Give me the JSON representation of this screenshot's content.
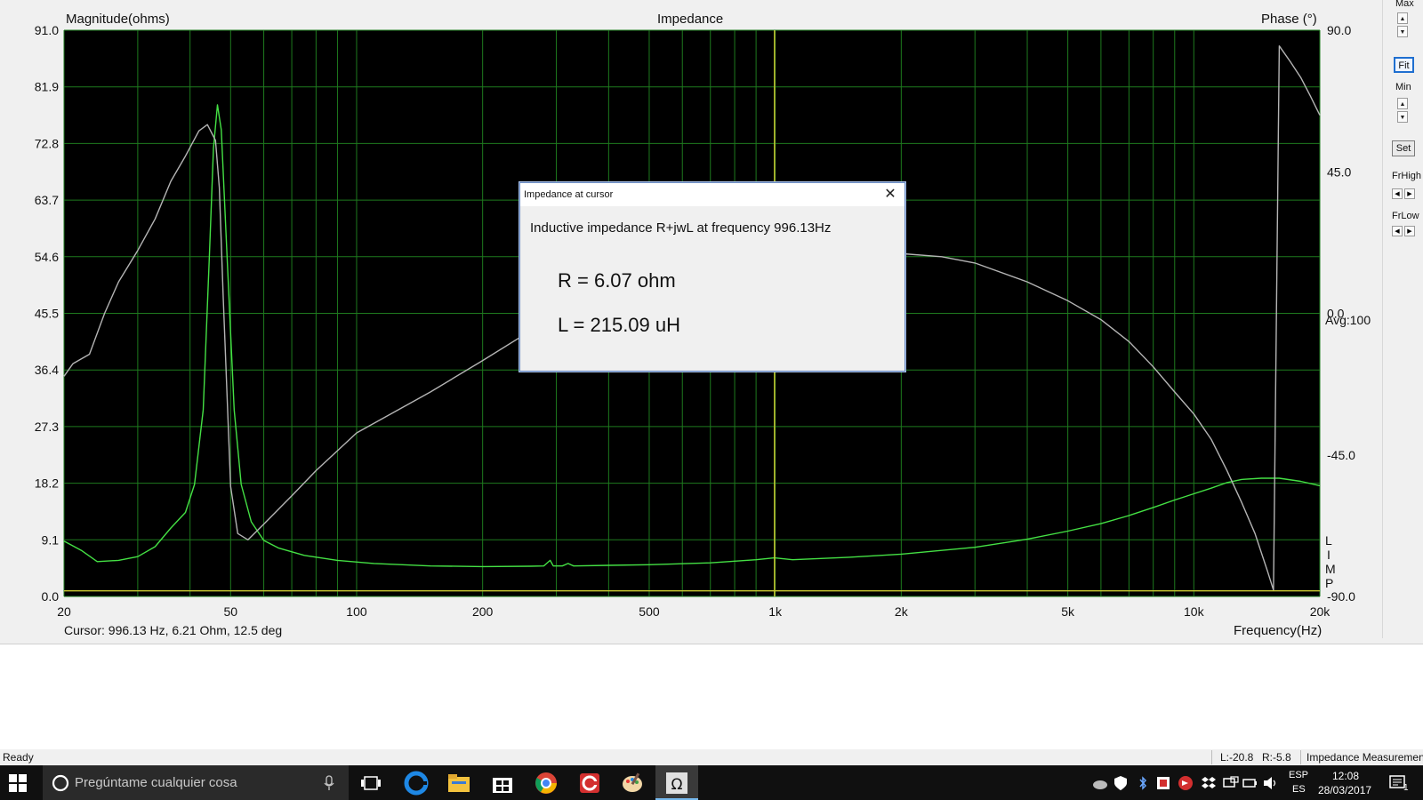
{
  "chart_data": {
    "type": "line",
    "title": "Impedance",
    "ylabel_left": "Magnitude(ohms)",
    "ylabel_right": "Phase (°)",
    "xlabel": "Frequency(Hz)",
    "x_scale": "log",
    "xlim": [
      20,
      20000
    ],
    "ylim_left": [
      0,
      91
    ],
    "ylim_right": [
      -90,
      90
    ],
    "grid": true,
    "background": "#000000",
    "grid_color": "#1e7a1e",
    "x_ticks": [
      {
        "value": 20,
        "label": "20"
      },
      {
        "value": 50,
        "label": "50"
      },
      {
        "value": 100,
        "label": "100"
      },
      {
        "value": 200,
        "label": "200"
      },
      {
        "value": 500,
        "label": "500"
      },
      {
        "value": 1000,
        "label": "1k"
      },
      {
        "value": 2000,
        "label": "2k"
      },
      {
        "value": 5000,
        "label": "5k"
      },
      {
        "value": 10000,
        "label": "10k"
      },
      {
        "value": 20000,
        "label": "20k"
      }
    ],
    "y_ticks_left": [
      "0.0",
      "9.1",
      "18.2",
      "27.3",
      "36.4",
      "45.5",
      "54.6",
      "63.7",
      "72.8",
      "81.9",
      "91.0"
    ],
    "y_ticks_right": [
      {
        "value": 90,
        "label": "90.0"
      },
      {
        "value": 45,
        "label": "45.0"
      },
      {
        "value": 0,
        "label": "0.0"
      },
      {
        "value": -45,
        "label": "-45.0"
      },
      {
        "value": -90,
        "label": "-90.0"
      }
    ],
    "cursor_x": 996.13,
    "series": [
      {
        "color": "#44e044",
        "axis": "left",
        "points": [
          [
            20,
            8.9
          ],
          [
            22,
            7.4
          ],
          [
            24,
            5.6
          ],
          [
            27,
            5.8
          ],
          [
            30,
            6.4
          ],
          [
            33,
            8.0
          ],
          [
            36,
            11.0
          ],
          [
            39,
            13.5
          ],
          [
            41,
            18.0
          ],
          [
            43,
            30.0
          ],
          [
            44.5,
            55.0
          ],
          [
            45.5,
            72.0
          ],
          [
            46.5,
            79.0
          ],
          [
            47.5,
            75.0
          ],
          [
            49,
            55.0
          ],
          [
            51,
            30.0
          ],
          [
            53,
            18.0
          ],
          [
            56,
            12.0
          ],
          [
            60,
            9.0
          ],
          [
            65,
            7.8
          ],
          [
            75,
            6.6
          ],
          [
            90,
            5.8
          ],
          [
            110,
            5.3
          ],
          [
            150,
            4.9
          ],
          [
            200,
            4.8
          ],
          [
            260,
            4.85
          ],
          [
            280,
            4.9
          ],
          [
            290,
            5.8
          ],
          [
            295,
            4.9
          ],
          [
            310,
            4.9
          ],
          [
            320,
            5.3
          ],
          [
            330,
            4.9
          ],
          [
            400,
            5.0
          ],
          [
            500,
            5.1
          ],
          [
            700,
            5.4
          ],
          [
            900,
            5.9
          ],
          [
            996,
            6.2
          ],
          [
            1100,
            5.9
          ],
          [
            1500,
            6.3
          ],
          [
            2000,
            6.8
          ],
          [
            3000,
            7.9
          ],
          [
            4000,
            9.2
          ],
          [
            5000,
            10.5
          ],
          [
            6000,
            11.7
          ],
          [
            7000,
            13.0
          ],
          [
            8000,
            14.3
          ],
          [
            9000,
            15.5
          ],
          [
            10000,
            16.5
          ],
          [
            11000,
            17.4
          ],
          [
            12000,
            18.3
          ],
          [
            13000,
            18.8
          ],
          [
            14500,
            19.0
          ],
          [
            16000,
            19.0
          ],
          [
            18000,
            18.5
          ],
          [
            20000,
            17.8
          ]
        ]
      },
      {
        "color": "#b4b4b4",
        "axis": "right",
        "points": [
          [
            20,
            -20.0
          ],
          [
            21,
            -16.0
          ],
          [
            23,
            -13.0
          ],
          [
            25,
            0.0
          ],
          [
            27,
            10.0
          ],
          [
            30,
            20.0
          ],
          [
            33,
            30.0
          ],
          [
            36,
            42.0
          ],
          [
            39,
            50.0
          ],
          [
            42,
            58.0
          ],
          [
            44,
            60.0
          ],
          [
            46,
            55.0
          ],
          [
            47,
            40.0
          ],
          [
            48,
            5.0
          ],
          [
            50,
            -55.0
          ],
          [
            52,
            -70.0
          ],
          [
            55,
            -72.0
          ],
          [
            60,
            -67.0
          ],
          [
            70,
            -58.0
          ],
          [
            80,
            -50.0
          ],
          [
            100,
            -38.0
          ],
          [
            150,
            -25.0
          ],
          [
            200,
            -15.0
          ],
          [
            250,
            -7.0
          ],
          [
            280,
            -3.0
          ],
          [
            290,
            4.0
          ],
          [
            300,
            -3.0
          ],
          [
            310,
            -5.0
          ],
          [
            320,
            0.0
          ],
          [
            330,
            -4.0
          ],
          [
            400,
            0.0
          ],
          [
            500,
            4.0
          ],
          [
            600,
            7.0
          ],
          [
            700,
            9.0
          ],
          [
            800,
            12.0
          ],
          [
            900,
            14.0
          ],
          [
            996,
            15.0
          ],
          [
            1100,
            12.0
          ],
          [
            1500,
            17.0
          ],
          [
            2000,
            19.0
          ],
          [
            2500,
            18.0
          ],
          [
            3000,
            16.0
          ],
          [
            4000,
            10.0
          ],
          [
            5000,
            4.0
          ],
          [
            6000,
            -2.0
          ],
          [
            7000,
            -9.0
          ],
          [
            8000,
            -17.0
          ],
          [
            9000,
            -25.0
          ],
          [
            10000,
            -32.0
          ],
          [
            11000,
            -40.0
          ],
          [
            12000,
            -50.0
          ],
          [
            13000,
            -60.0
          ],
          [
            14000,
            -70.0
          ],
          [
            15000,
            -82.0
          ],
          [
            15500,
            -88.0
          ],
          [
            16000,
            85.0
          ],
          [
            17000,
            80.0
          ],
          [
            18000,
            75.0
          ],
          [
            19000,
            69.0
          ],
          [
            20000,
            63.0
          ]
        ]
      },
      {
        "color": "#c8c832",
        "axis": "left",
        "points": [
          [
            20,
            0.9
          ],
          [
            35,
            0.9
          ],
          [
            100,
            0.9
          ],
          [
            1000,
            0.9
          ],
          [
            20000,
            0.9
          ]
        ]
      }
    ]
  },
  "plot": {
    "title": "Impedance",
    "left_axis_title": "Magnitude(ohms)",
    "right_axis_title": "Phase (°)",
    "x_axis_title": "Frequency(Hz)",
    "cursor_readout": "Cursor: 996.13 Hz, 6.21 Ohm, 12.5 deg",
    "avg_label": "Avg:100",
    "trace_letters": [
      "L",
      "I",
      "M",
      "P"
    ]
  },
  "side_panel": {
    "max_label": "Max",
    "fit_label": "Fit",
    "min_label": "Min",
    "set_label": "Set",
    "frhigh_label": "FrHigh",
    "frlow_label": "FrLow"
  },
  "dialog": {
    "title": "Impedance at cursor",
    "close_glyph": "✕",
    "message": "Inductive impedance R+jwL at frequency 996.13Hz",
    "r_value": "R = 6.07 ohm",
    "l_value": "L = 215.09 uH"
  },
  "status_bar": {
    "ready": "Ready",
    "left_level": "L:-20.8",
    "right_level": "R:-5.8",
    "mode": "Impedance Measuremen"
  },
  "taskbar": {
    "search_placeholder": "Pregúntame cualquier cosa",
    "language": "ESP",
    "layout": "ES",
    "time": "12:08",
    "date": "28/03/2017",
    "notification_count": "1",
    "icons": [
      "windows-start-icon",
      "cortana-icon",
      "microphone-icon",
      "task-view-icon",
      "edge-icon",
      "file-explorer-icon",
      "store-icon",
      "chrome-icon",
      "ccleaner-icon",
      "paint-icon",
      "impedance-app-icon"
    ]
  }
}
